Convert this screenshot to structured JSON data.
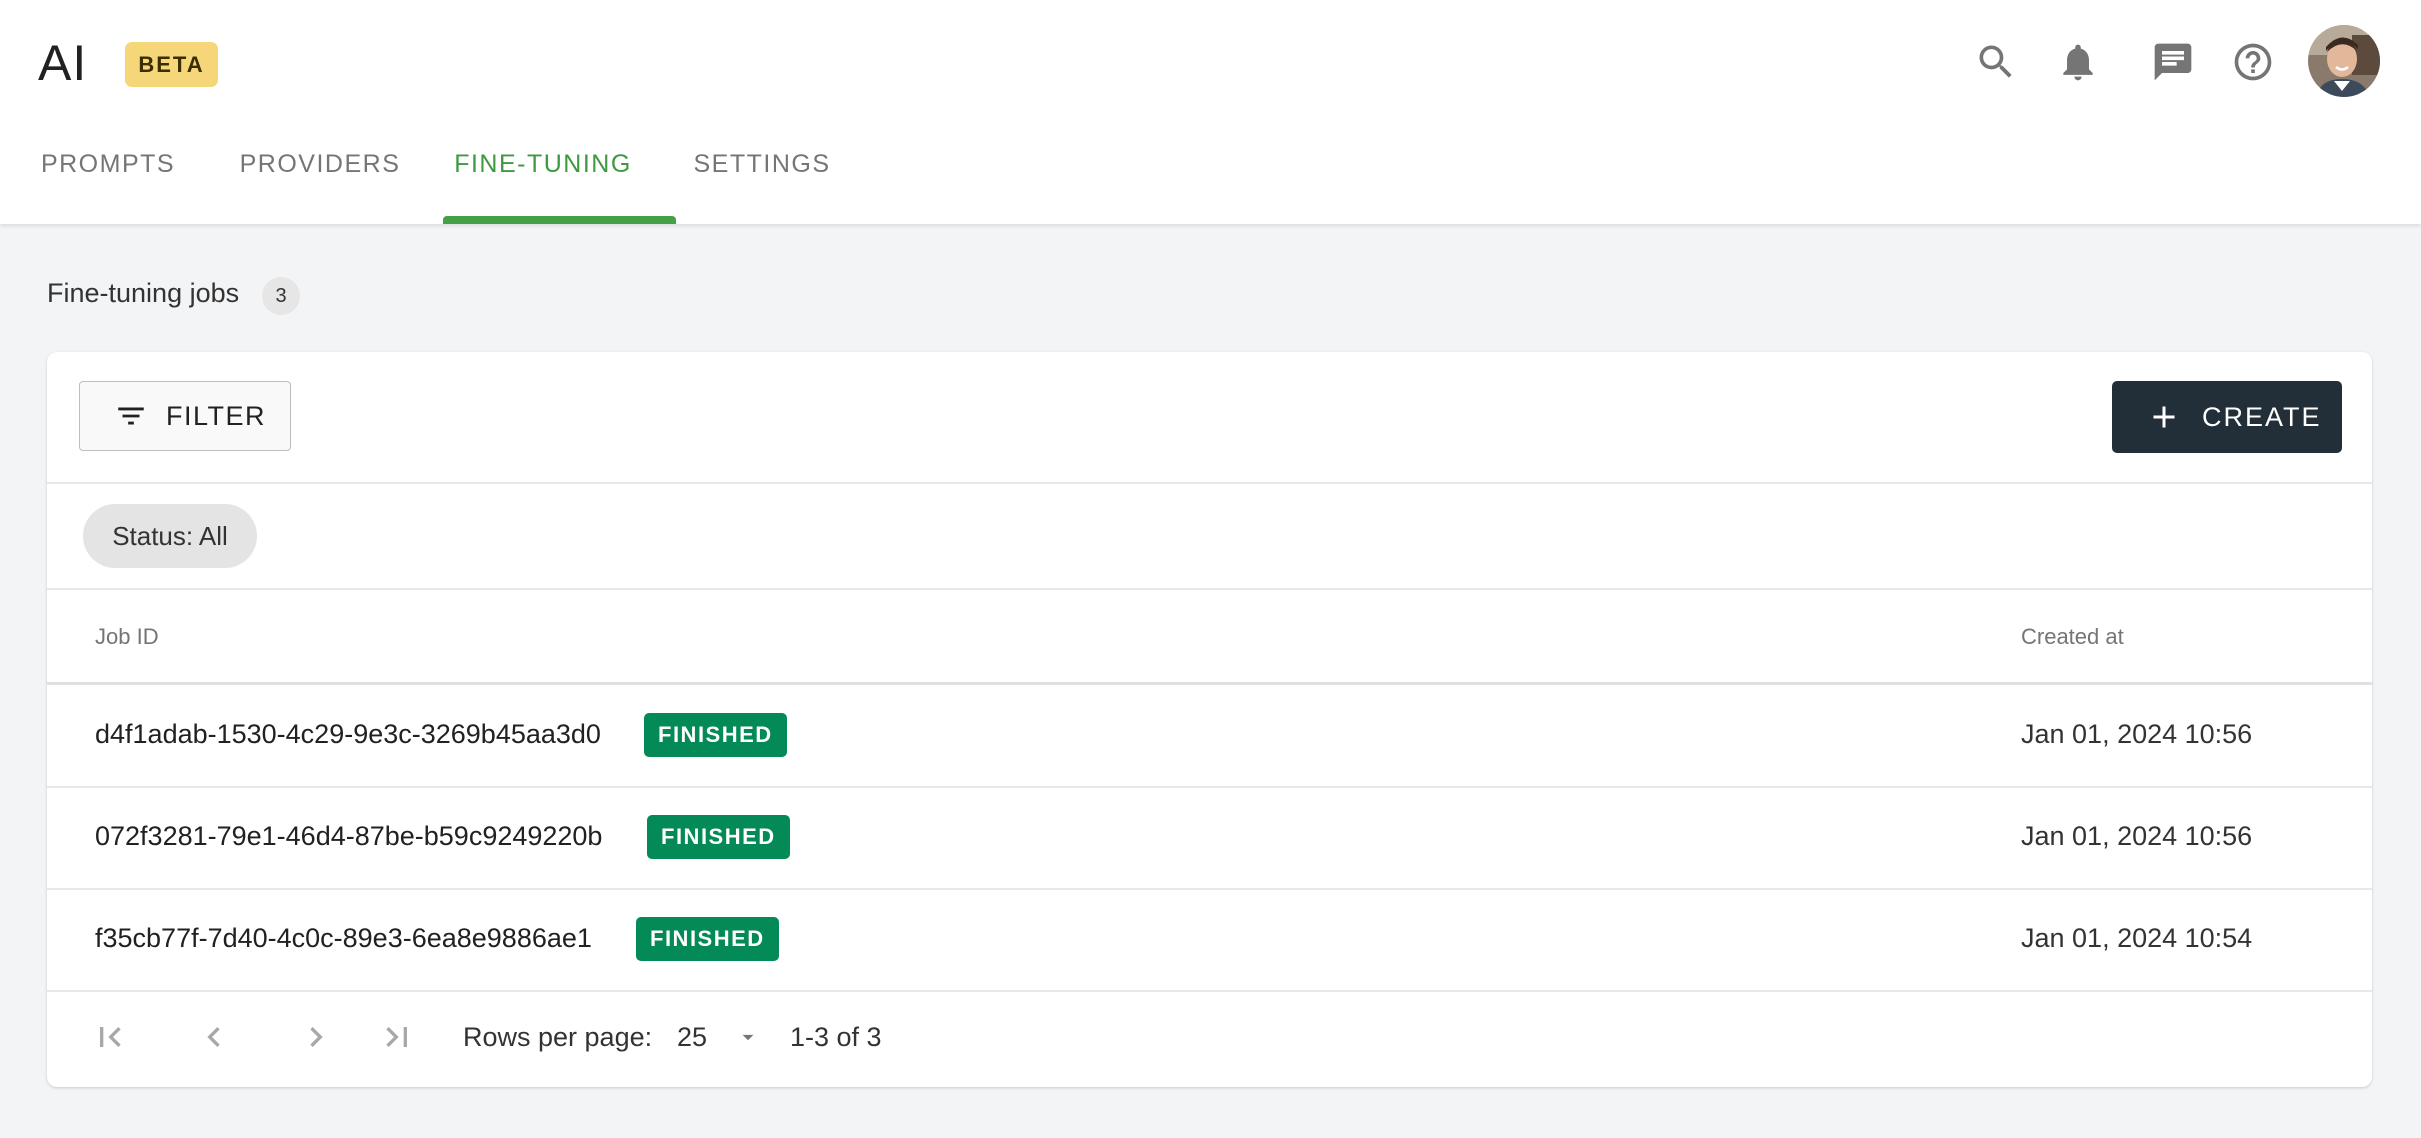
{
  "header": {
    "app_title": "AI",
    "beta_label": "BETA",
    "icons": [
      "search-icon",
      "bell-icon",
      "chat-icon",
      "help-icon",
      "avatar"
    ]
  },
  "tabs": [
    {
      "label": "PROMPTS",
      "active": false
    },
    {
      "label": "PROVIDERS",
      "active": false
    },
    {
      "label": "FINE-TUNING",
      "active": true
    },
    {
      "label": "SETTINGS",
      "active": false
    }
  ],
  "section": {
    "title": "Fine-tuning jobs",
    "count": "3"
  },
  "toolbar": {
    "filter_label": "FILTER",
    "create_label": "CREATE"
  },
  "filter_chip": "Status: All",
  "table": {
    "columns": [
      "Job ID",
      "Created at"
    ],
    "rows": [
      {
        "job_id": "d4f1adab-1530-4c29-9e3c-3269b45aa3d0",
        "status": "FINISHED",
        "created_at": "Jan 01, 2024 10:56"
      },
      {
        "job_id": "072f3281-79e1-46d4-87be-b59c9249220b",
        "status": "FINISHED",
        "created_at": "Jan 01, 2024 10:56"
      },
      {
        "job_id": "f35cb77f-7d40-4c0c-89e3-6ea8e9886ae1",
        "status": "FINISHED",
        "created_at": "Jan 01, 2024 10:54"
      }
    ]
  },
  "pagination": {
    "rows_per_page_label": "Rows per page:",
    "rows_per_page_value": "25",
    "range_text": "1-3 of 3"
  },
  "colors": {
    "active_tab": "#3d9a3f",
    "beta_badge": "#f5d77a",
    "status_finished": "#038a56",
    "create_button": "#232f38"
  }
}
